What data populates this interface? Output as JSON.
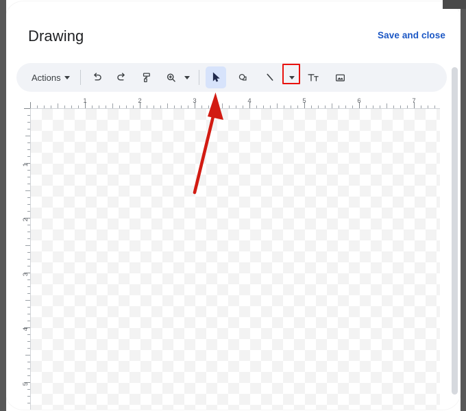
{
  "window": {
    "title": "Drawing"
  },
  "header": {
    "title": "Drawing",
    "save_label": "Save and close",
    "save_color": "#1a56c4"
  },
  "toolbar": {
    "actions_label": "Actions",
    "items": [
      {
        "name": "actions-menu",
        "label": "Actions",
        "icon": "caret-down-icon"
      },
      {
        "name": "undo-button",
        "label": "Undo",
        "icon": "undo-icon"
      },
      {
        "name": "redo-button",
        "label": "Redo",
        "icon": "redo-icon"
      },
      {
        "name": "paint-format-button",
        "label": "Paint format",
        "icon": "paint-roller-icon"
      },
      {
        "name": "zoom-button",
        "label": "Zoom",
        "icon": "magnifier-plus-icon"
      },
      {
        "name": "select-tool",
        "label": "Select",
        "icon": "cursor-arrow-icon",
        "active": true
      },
      {
        "name": "shape-tool",
        "label": "Shape",
        "icon": "shape-icon"
      },
      {
        "name": "line-tool",
        "label": "Line",
        "icon": "line-icon"
      },
      {
        "name": "line-style-dropdown",
        "label": "Line style",
        "icon": "caret-down-icon",
        "highlighted": true
      },
      {
        "name": "text-box-tool",
        "label": "Text box",
        "icon": "text-tt-icon"
      },
      {
        "name": "image-tool",
        "label": "Image",
        "icon": "image-icon"
      }
    ],
    "background": "#f1f3f7",
    "active_background": "#d7e3fb"
  },
  "rulers": {
    "horizontal_labels": [
      "1",
      "2",
      "3",
      "4",
      "5",
      "6",
      "7"
    ],
    "vertical_labels": [
      "1",
      "2",
      "3",
      "4",
      "5"
    ],
    "unit": "inch"
  },
  "canvas": {
    "background": "transparent-checkerboard",
    "checker_light": "#ffffff",
    "checker_dark": "#f3f3f3"
  },
  "annotation": {
    "type": "arrow",
    "color": "#d21b12",
    "points_to": "line-style-dropdown",
    "highlight_box_color": "#e8110d"
  }
}
